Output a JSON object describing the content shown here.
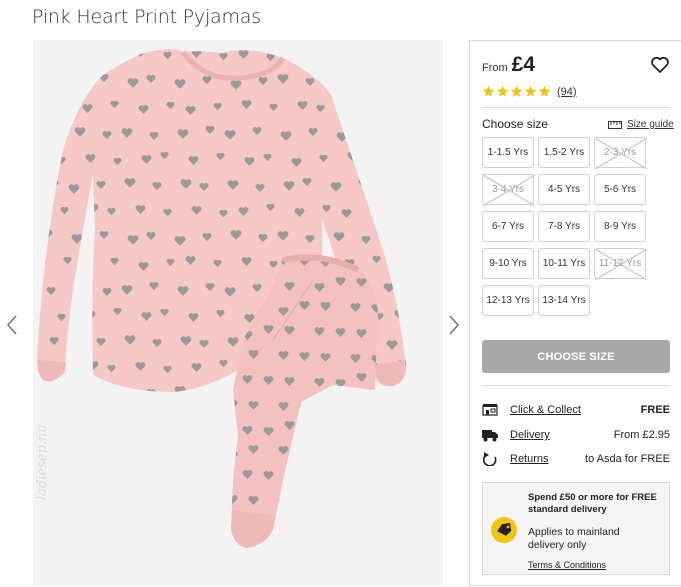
{
  "product": {
    "title": "Pink Heart Print Pyjamas",
    "price_prefix": "From",
    "price": "£4",
    "rating_stars": 5,
    "review_count": "(94)"
  },
  "gallery": {
    "watermark": "ladiesep.nu",
    "prev_icon": "chevron-left-icon",
    "next_icon": "chevron-right-icon"
  },
  "size_section": {
    "heading": "Choose size",
    "guide_label": "Size guide",
    "sizes": [
      {
        "label": "1-1.5 Yrs",
        "available": true
      },
      {
        "label": "1.5-2 Yrs",
        "available": true
      },
      {
        "label": "2-3 Yrs",
        "available": false
      },
      {
        "label": "3-4 Yrs",
        "available": false
      },
      {
        "label": "4-5 Yrs",
        "available": true
      },
      {
        "label": "5-6 Yrs",
        "available": true
      },
      {
        "label": "6-7 Yrs",
        "available": true
      },
      {
        "label": "7-8 Yrs",
        "available": true
      },
      {
        "label": "8-9 Yrs",
        "available": true
      },
      {
        "label": "9-10 Yrs",
        "available": true
      },
      {
        "label": "10-11 Yrs",
        "available": true
      },
      {
        "label": "11-12 Yrs",
        "available": false
      },
      {
        "label": "12-13 Yrs",
        "available": true
      },
      {
        "label": "13-14 Yrs",
        "available": true
      }
    ]
  },
  "cta": {
    "label": "CHOOSE SIZE"
  },
  "delivery": [
    {
      "icon": "store-icon",
      "label": "Click & Collect",
      "value": "FREE"
    },
    {
      "icon": "truck-icon",
      "label": "Delivery",
      "value": "From £2.95"
    },
    {
      "icon": "returns-icon",
      "label": "Returns",
      "value": "to Asda for FREE"
    }
  ],
  "promo": {
    "headline": "Spend £50 or more for FREE standard delivery",
    "body": "Applies to mainland delivery only",
    "link": "Terms & Conditions",
    "icon": "tag-icon"
  },
  "colors": {
    "star": "#f2c40e",
    "button_disabled": "#a9a9a9",
    "pyjama_pink": "#f6c9c7",
    "heart_grey": "#9a9a9a"
  }
}
